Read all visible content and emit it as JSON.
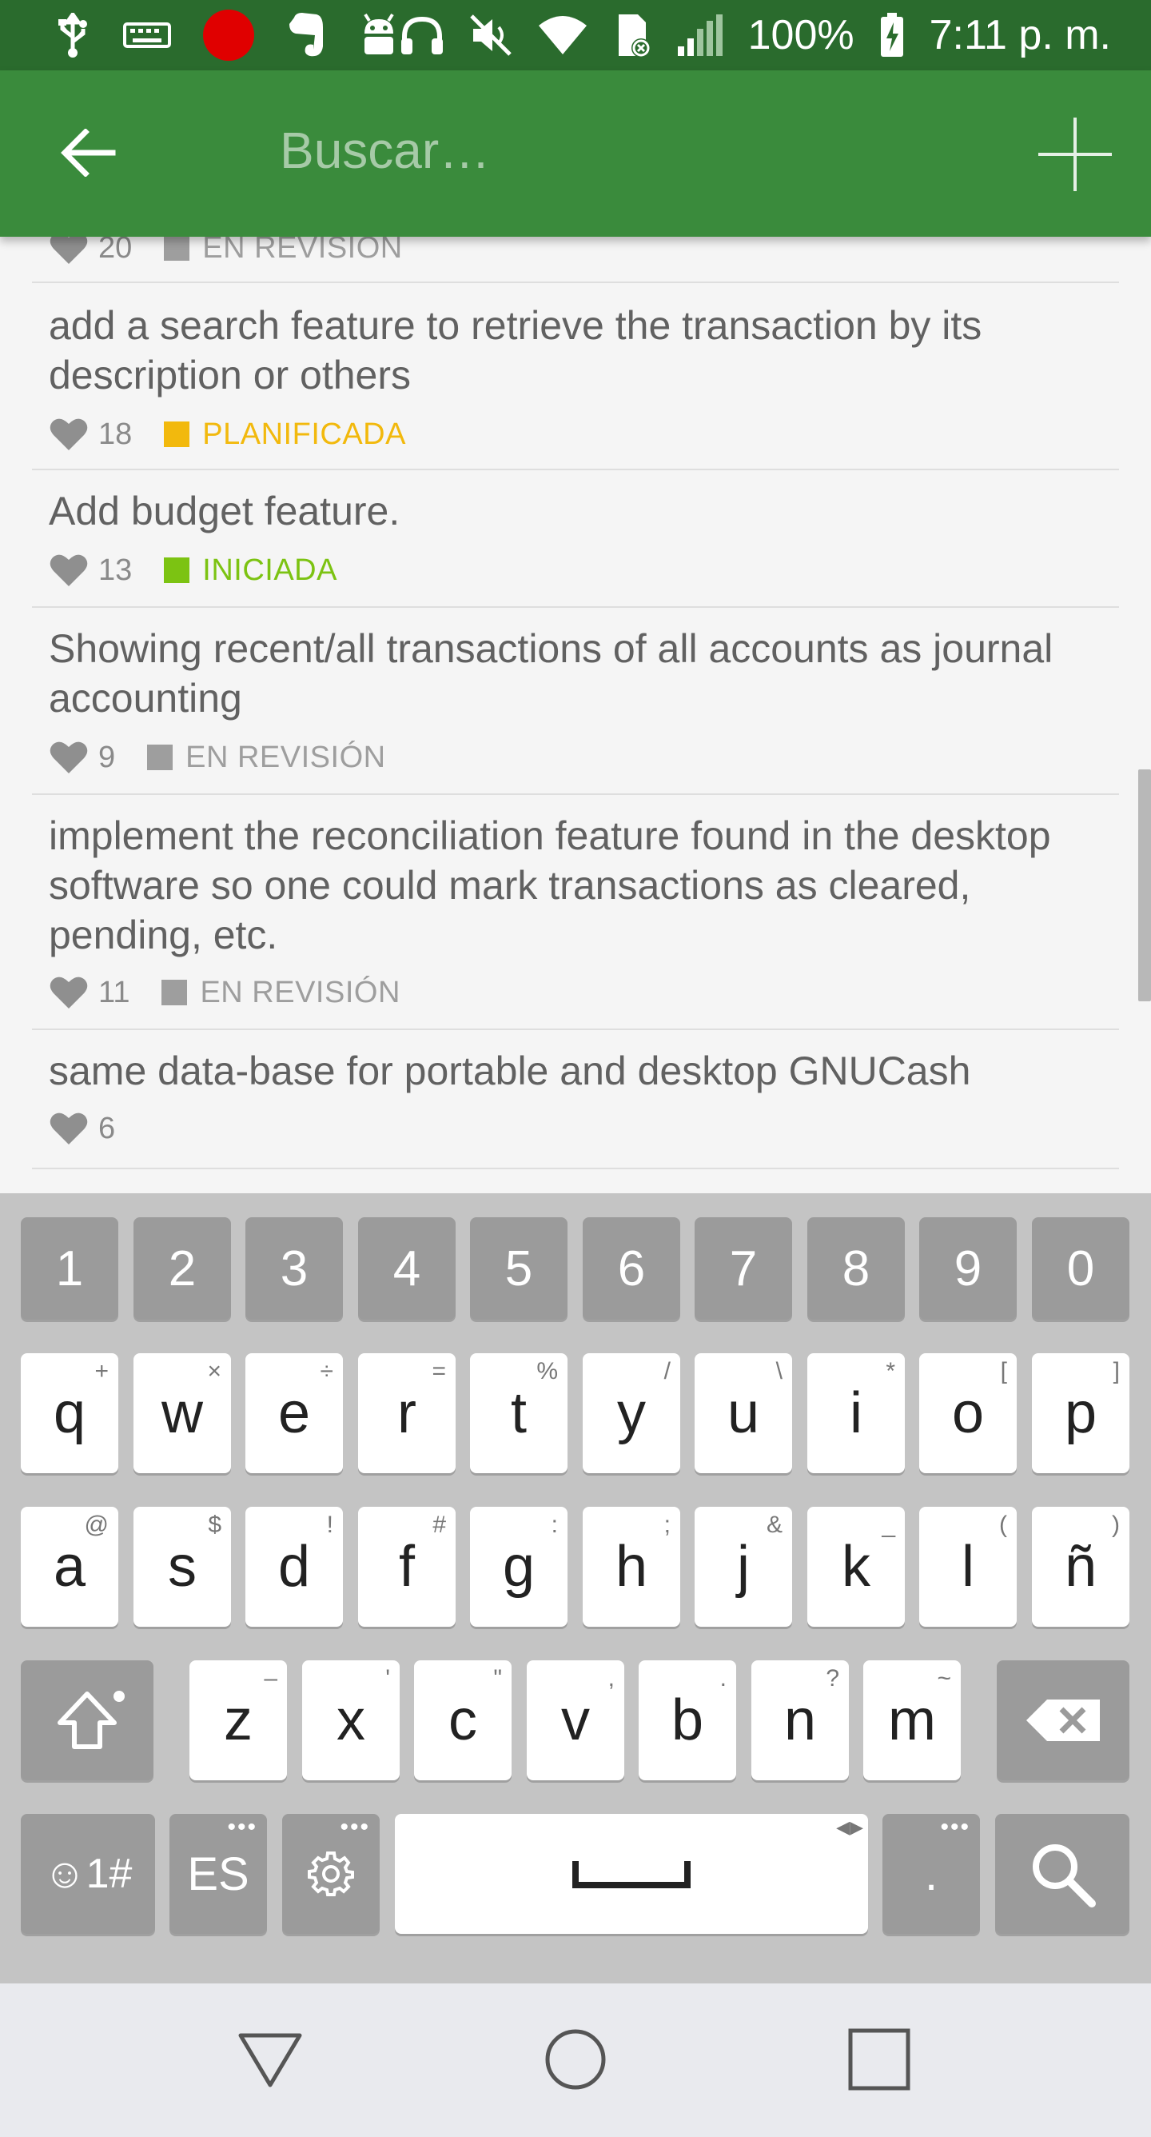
{
  "status_bar": {
    "battery": "100%",
    "time": "7:11 p. m."
  },
  "app_bar": {
    "search_placeholder": "Buscar…",
    "back_icon": "arrow-left-icon",
    "add_icon": "plus-icon"
  },
  "list": {
    "partial_item": {
      "votes": "20",
      "status": "EN REVISIÓN",
      "status_color": "#9e9e9e"
    },
    "items": [
      {
        "title": "add a search feature to retrieve the transaction by its description or others",
        "votes": "18",
        "status": "PLANIFICADA",
        "status_color": "#f2b90d"
      },
      {
        "title": "Add budget feature.",
        "votes": "13",
        "status": "INICIADA",
        "status_color": "#7cc312"
      },
      {
        "title": "Showing recent/all transactions of all accounts as journal accounting",
        "votes": "9",
        "status": "EN REVISIÓN",
        "status_color": "#9e9e9e"
      },
      {
        "title": "implement the reconciliation feature found in the desktop software so one could mark transactions as cleared, pending, etc.",
        "votes": "11",
        "status": "EN REVISIÓN",
        "status_color": "#9e9e9e"
      },
      {
        "title": "same data-base for portable and desktop GNUCash",
        "votes": "6",
        "status": "",
        "status_color": ""
      }
    ]
  },
  "keyboard": {
    "number_row": [
      "1",
      "2",
      "3",
      "4",
      "5",
      "6",
      "7",
      "8",
      "9",
      "0"
    ],
    "row1": [
      {
        "key": "q",
        "alt": "+"
      },
      {
        "key": "w",
        "alt": "×"
      },
      {
        "key": "e",
        "alt": "÷"
      },
      {
        "key": "r",
        "alt": "="
      },
      {
        "key": "t",
        "alt": "%"
      },
      {
        "key": "y",
        "alt": "/"
      },
      {
        "key": "u",
        "alt": "\\"
      },
      {
        "key": "i",
        "alt": "*"
      },
      {
        "key": "o",
        "alt": "["
      },
      {
        "key": "p",
        "alt": "]"
      }
    ],
    "row2": [
      {
        "key": "a",
        "alt": "@"
      },
      {
        "key": "s",
        "alt": "$"
      },
      {
        "key": "d",
        "alt": "!"
      },
      {
        "key": "f",
        "alt": "#"
      },
      {
        "key": "g",
        "alt": ":"
      },
      {
        "key": "h",
        "alt": ";"
      },
      {
        "key": "j",
        "alt": "&"
      },
      {
        "key": "k",
        "alt": "_"
      },
      {
        "key": "l",
        "alt": "("
      },
      {
        "key": "ñ",
        "alt": ")"
      }
    ],
    "row3": [
      {
        "key": "z",
        "alt": "–"
      },
      {
        "key": "x",
        "alt": "'"
      },
      {
        "key": "c",
        "alt": "\""
      },
      {
        "key": "v",
        "alt": ","
      },
      {
        "key": "b",
        "alt": "."
      },
      {
        "key": "n",
        "alt": "?"
      },
      {
        "key": "m",
        "alt": "~"
      }
    ],
    "symbols_label": "☺1#",
    "language_label": "ES",
    "period_label": "."
  }
}
